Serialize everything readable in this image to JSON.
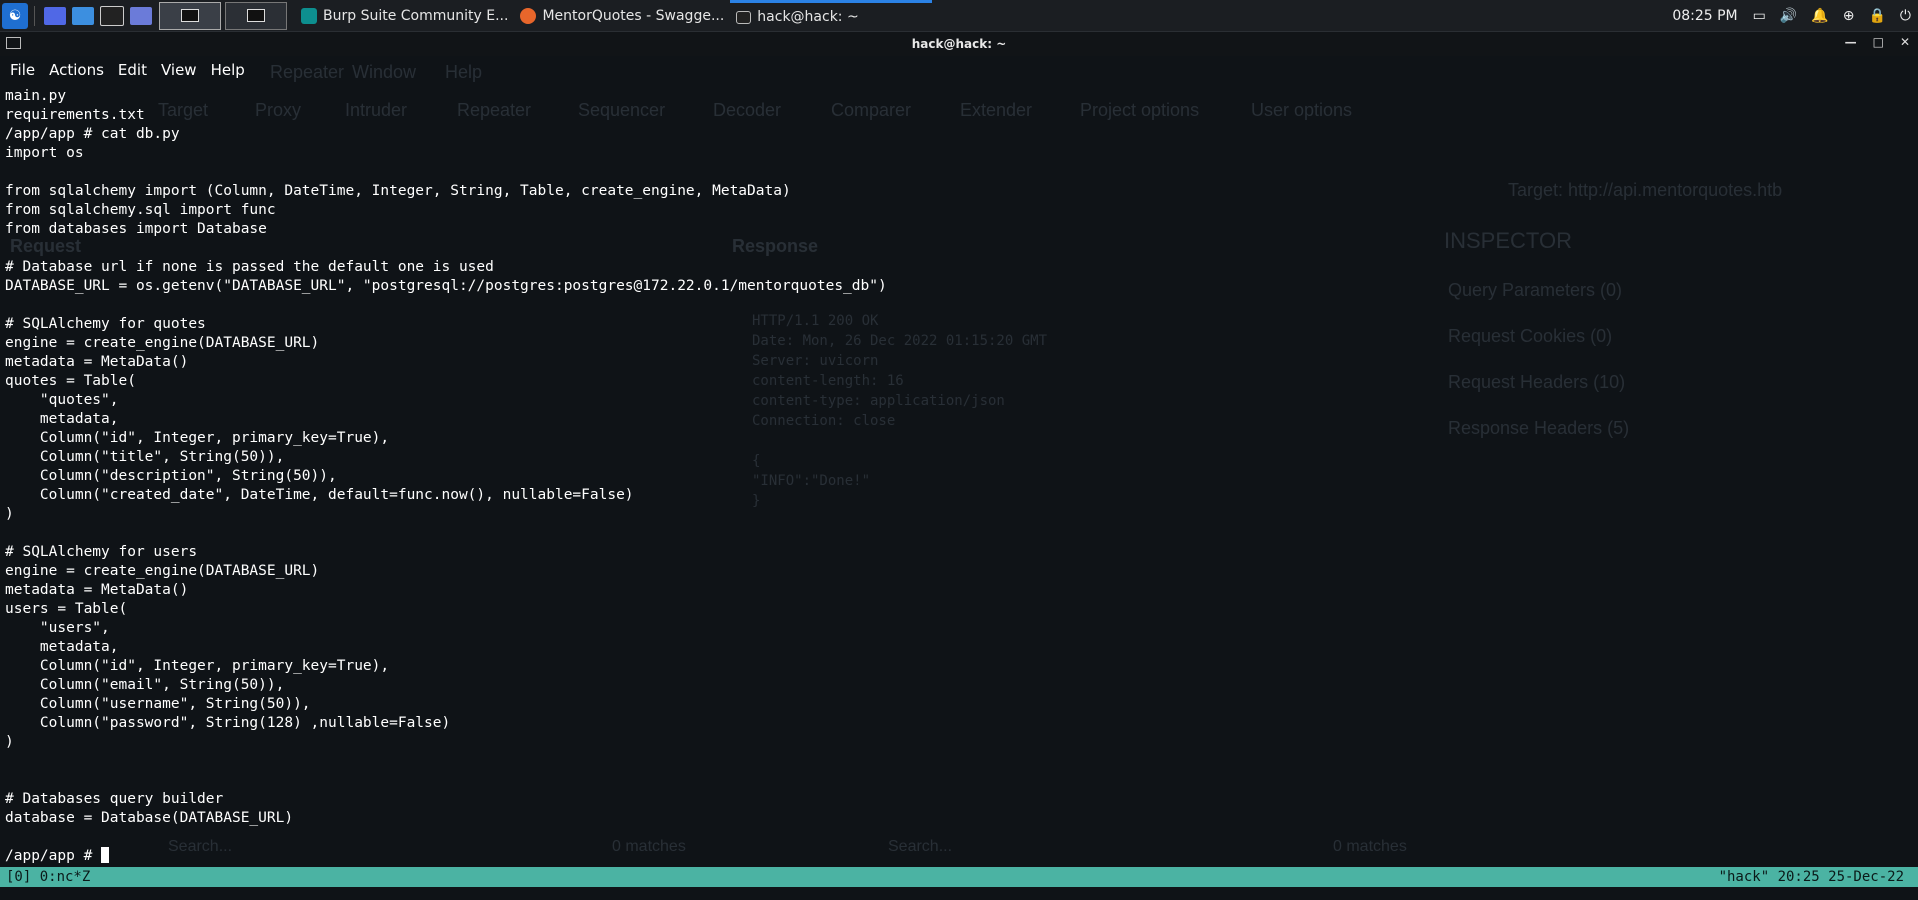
{
  "taskbar": {
    "tasks": [
      {
        "label": "Burp Suite Community E..."
      },
      {
        "label": "MentorQuotes - Swagge..."
      },
      {
        "label": "hack@hack: ~"
      }
    ],
    "clock": "08:25 PM"
  },
  "window": {
    "title": "hack@hack: ~",
    "menu": [
      "File",
      "Actions",
      "Edit",
      "View",
      "Help"
    ]
  },
  "terminal": {
    "lines": [
      "main.py",
      "requirements.txt",
      "/app/app # cat db.py",
      "import os",
      "",
      "from sqlalchemy import (Column, DateTime, Integer, String, Table, create_engine, MetaData)",
      "from sqlalchemy.sql import func",
      "from databases import Database",
      "",
      "# Database url if none is passed the default one is used",
      "DATABASE_URL = os.getenv(\"DATABASE_URL\", \"postgresql://postgres:postgres@172.22.0.1/mentorquotes_db\")",
      "",
      "# SQLAlchemy for quotes",
      "engine = create_engine(DATABASE_URL)",
      "metadata = MetaData()",
      "quotes = Table(",
      "    \"quotes\",",
      "    metadata,",
      "    Column(\"id\", Integer, primary_key=True),",
      "    Column(\"title\", String(50)),",
      "    Column(\"description\", String(50)),",
      "    Column(\"created_date\", DateTime, default=func.now(), nullable=False)",
      ")",
      "",
      "# SQLAlchemy for users",
      "engine = create_engine(DATABASE_URL)",
      "metadata = MetaData()",
      "users = Table(",
      "    \"users\",",
      "    metadata,",
      "    Column(\"id\", Integer, primary_key=True),",
      "    Column(\"email\", String(50)),",
      "    Column(\"username\", String(50)),",
      "    Column(\"password\", String(128) ,nullable=False)",
      ")",
      "",
      "",
      "# Databases query builder",
      "database = Database(DATABASE_URL)",
      ""
    ],
    "prompt": "/app/app # "
  },
  "statusbar": {
    "left": "[0] 0:nc*Z",
    "right": "\"hack\" 20:25 25-Dec-22"
  },
  "background_window": {
    "menu": [
      "Repeater",
      "Window",
      "Help"
    ],
    "tabs": [
      "Target",
      "Proxy",
      "Intruder",
      "Repeater",
      "Sequencer",
      "Decoder",
      "Comparer",
      "Extender",
      "Project options",
      "User options"
    ],
    "request_label": "Request",
    "response_label": "Response",
    "target": "Target: http://api.mentorquotes.htb",
    "inspector": "INSPECTOR",
    "inspector_items": [
      "Query Parameters (0)",
      "Request Cookies (0)",
      "Request Headers (10)",
      "Response Headers (5)"
    ],
    "response_lines": [
      "HTTP/1.1 200 OK",
      "Date: Mon, 26 Dec 2022 01:15:20 GMT",
      "Server: uvicorn",
      "content-length: 16",
      "content-type: application/json",
      "Connection: close",
      "",
      "{",
      "  \"INFO\":\"Done!\"",
      "}"
    ],
    "matches": "0 matches",
    "search": "Search..."
  }
}
